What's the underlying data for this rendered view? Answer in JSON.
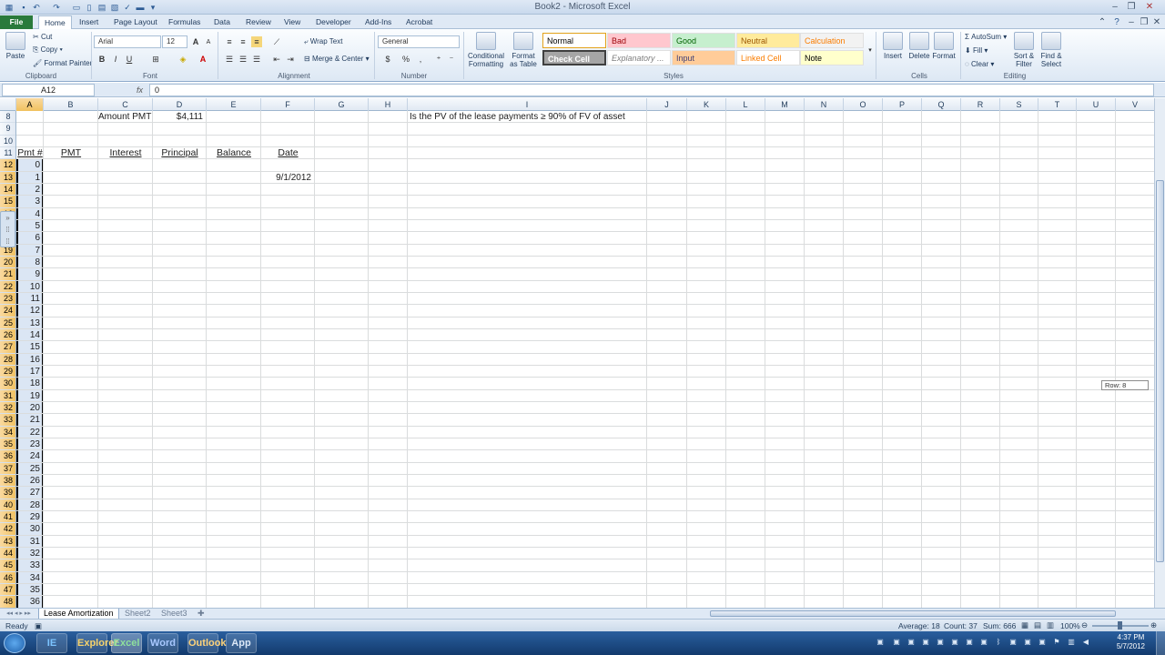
{
  "window": {
    "title": "Book2 - Microsoft Excel"
  },
  "tabs": [
    "File",
    "Home",
    "Insert",
    "Page Layout",
    "Formulas",
    "Data",
    "Review",
    "View",
    "Developer",
    "Add-Ins",
    "Acrobat"
  ],
  "ribbon": {
    "clipboard": {
      "paste": "Paste",
      "cut": "Cut",
      "copy": "Copy",
      "format_painter": "Format Painter",
      "label": "Clipboard"
    },
    "font": {
      "name": "Arial",
      "size": "12",
      "bold": "B",
      "italic": "I",
      "underline": "U",
      "grow": "A",
      "shrink": "A",
      "font_color_glyph": "A",
      "label": "Font"
    },
    "alignment": {
      "wrap": "Wrap Text",
      "merge": "Merge & Center",
      "label": "Alignment"
    },
    "number": {
      "format": "General",
      "currency": "$",
      "percent": "%",
      "comma": ",",
      "label": "Number"
    },
    "styles": {
      "conditional": "Conditional Formatting",
      "format_table": "Format as Table",
      "label": "Styles",
      "cells": [
        {
          "name": "Normal",
          "bg": "#ffffff",
          "fg": "#000000"
        },
        {
          "name": "Bad",
          "bg": "#ffc7ce",
          "fg": "#9c0006"
        },
        {
          "name": "Good",
          "bg": "#c6efce",
          "fg": "#006100"
        },
        {
          "name": "Neutral",
          "bg": "#ffeb9c",
          "fg": "#9c5700"
        },
        {
          "name": "Calculation",
          "bg": "#f2f2f2",
          "fg": "#fa7d00"
        },
        {
          "name": "Check Cell",
          "bg": "#a5a5a5",
          "fg": "#ffffff"
        },
        {
          "name": "Explanatory ...",
          "bg": "#ffffff",
          "fg": "#7f7f7f"
        },
        {
          "name": "Input",
          "bg": "#ffcc99",
          "fg": "#3f3f76"
        },
        {
          "name": "Linked Cell",
          "bg": "#ffffff",
          "fg": "#fa7d00"
        },
        {
          "name": "Note",
          "bg": "#ffffcc",
          "fg": "#000000"
        }
      ]
    },
    "cells": {
      "insert": "Insert",
      "delete": "Delete",
      "format": "Format",
      "label": "Cells"
    },
    "editing": {
      "autosum": "AutoSum",
      "fill": "Fill",
      "clear": "Clear",
      "sort": "Sort & Filter",
      "find": "Find & Select",
      "label": "Editing"
    }
  },
  "formula_bar": {
    "name_box": "A12",
    "fx": "fx",
    "content": "0"
  },
  "columns": [
    "A",
    "B",
    "C",
    "D",
    "E",
    "F",
    "G",
    "H",
    "I",
    "J",
    "K",
    "L",
    "M",
    "N",
    "O",
    "P",
    "Q",
    "R",
    "S",
    "T",
    "U",
    "V"
  ],
  "rows": [
    8,
    9,
    10,
    11,
    12,
    13,
    14,
    15,
    16,
    17,
    18,
    19,
    20,
    21,
    22,
    23,
    24,
    25,
    26,
    27,
    28,
    29,
    30,
    31,
    32,
    33,
    34,
    35,
    36,
    37,
    38,
    39,
    40,
    41,
    42,
    43,
    44,
    45,
    46,
    47,
    48
  ],
  "sheet": {
    "amount_label": "Amount PMT",
    "amount_value": "$4,111",
    "question": "Is the PV of the lease payments ≥ 90% of FV of asset",
    "headers": [
      "Pmt #",
      "PMT",
      "Interest",
      "Principal",
      "Balance",
      "Date"
    ],
    "start_date": "9/1/2012",
    "pmt_numbers": [
      0,
      1,
      2,
      3,
      4,
      5,
      6,
      7,
      8,
      9,
      10,
      11,
      12,
      13,
      14,
      15,
      16,
      17,
      18,
      19,
      20,
      21,
      22,
      23,
      24,
      25,
      26,
      27,
      28,
      29,
      30,
      31,
      32,
      33,
      34,
      35,
      36
    ]
  },
  "row_tip": "Row: 8",
  "sheet_tabs": [
    "Lease Amortization",
    "Sheet2",
    "Sheet3"
  ],
  "status": {
    "ready": "Ready",
    "average": "Average: 18",
    "count": "Count: 37",
    "sum": "Sum: 666",
    "zoom": "100%"
  },
  "taskbar": {
    "apps": [
      "IE",
      "Explorer",
      "Excel",
      "Word",
      "Outlook",
      "App"
    ],
    "time": "4:37 PM",
    "date": "5/7/2012"
  }
}
